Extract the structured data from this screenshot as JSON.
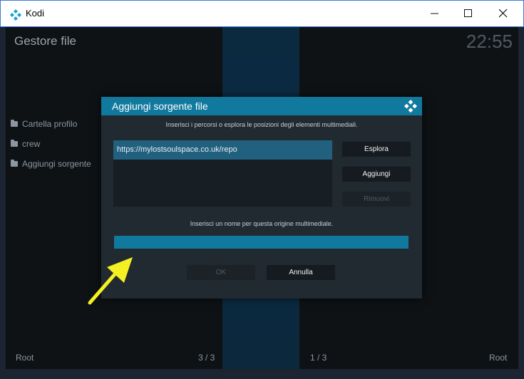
{
  "window": {
    "title": "Kodi",
    "controls": {
      "minimize": "—",
      "maximize": "☐",
      "close": "✕"
    }
  },
  "header": {
    "title": "Gestore file",
    "clock": "22:55"
  },
  "sidebar": {
    "items": [
      {
        "label": "Cartella profilo",
        "icon": "folder-icon"
      },
      {
        "label": "crew",
        "icon": "folder-icon"
      },
      {
        "label": "Aggiungi sorgente",
        "icon": "folder-icon"
      }
    ]
  },
  "footer": {
    "left": "Root",
    "left_count": "3 / 3",
    "right_count": "1 / 3",
    "right": "Root"
  },
  "dialog": {
    "title": "Aggiungi sorgente file",
    "paths_instruction": "Inserisci i percorsi o esplora le posizioni degli elementi multimediali.",
    "paths": [
      "https://mylostsoulspace.co.uk/repo"
    ],
    "browse_label": "Esplora",
    "add_label": "Aggiungi",
    "remove_label": "Rimuovi",
    "name_instruction": "Inserisci un nome per questa origine multimediale.",
    "name_value": "",
    "ok_label": "OK",
    "cancel_label": "Annulla"
  },
  "colors": {
    "accent": "#12799e",
    "selection": "#21607e",
    "arrow": "#f5f022"
  }
}
